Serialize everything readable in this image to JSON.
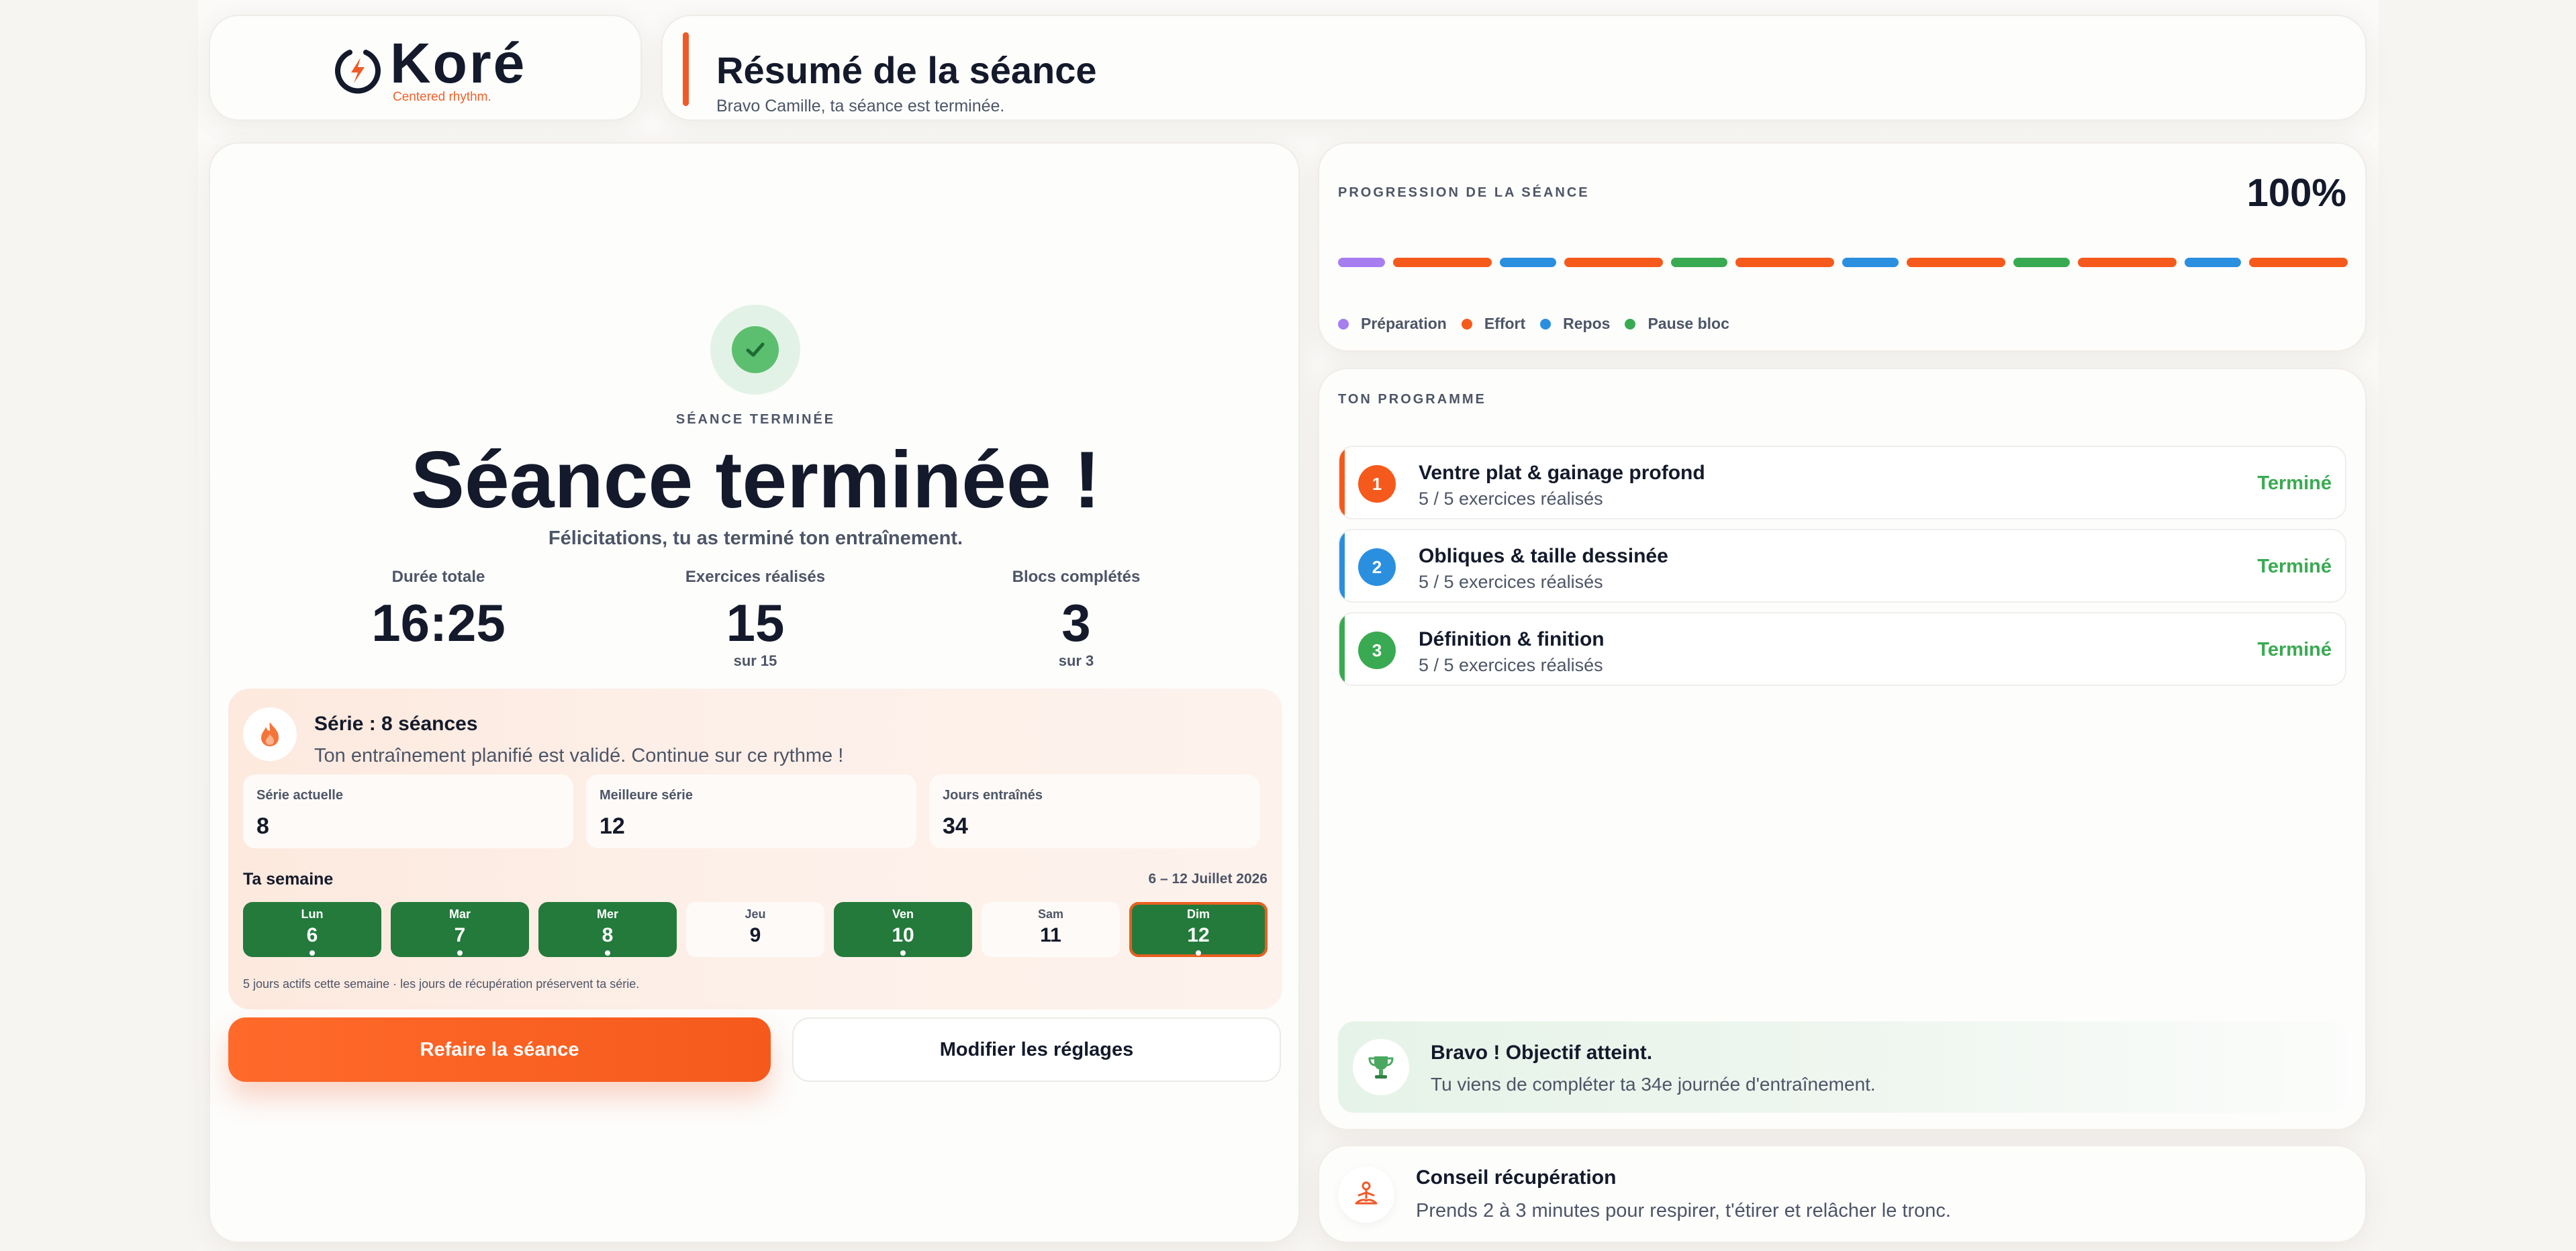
{
  "brand": {
    "name": "Koré",
    "tagline": "Centered rhythm."
  },
  "header": {
    "title": "Résumé de la séance",
    "subtitle": "Bravo Camille, ta séance est terminée."
  },
  "completion": {
    "eyebrow": "SÉANCE TERMINÉE",
    "title": "Séance terminée !",
    "subtitle": "Félicitations, tu as terminé ton entraînement."
  },
  "stats": [
    {
      "label": "Durée totale",
      "value": "16:25",
      "sub": ""
    },
    {
      "label": "Exercices réalisés",
      "value": "15",
      "sub": "sur 15"
    },
    {
      "label": "Blocs complétés",
      "value": "3",
      "sub": "sur 3"
    }
  ],
  "streak": {
    "title": "Série : 8 séances",
    "description": "Ton entraînement planifié est validé. Continue sur ce rythme !",
    "cards": [
      {
        "label": "Série actuelle",
        "value": "8"
      },
      {
        "label": "Meilleure série",
        "value": "12"
      },
      {
        "label": "Jours entraînés",
        "value": "34"
      }
    ],
    "week_title": "Ta semaine",
    "week_range": "6 – 12 Juillet 2026",
    "days": [
      {
        "name": "Lun",
        "num": "6",
        "active": true,
        "today": false
      },
      {
        "name": "Mar",
        "num": "7",
        "active": true,
        "today": false
      },
      {
        "name": "Mer",
        "num": "8",
        "active": true,
        "today": false
      },
      {
        "name": "Jeu",
        "num": "9",
        "active": false,
        "today": false
      },
      {
        "name": "Ven",
        "num": "10",
        "active": true,
        "today": false
      },
      {
        "name": "Sam",
        "num": "11",
        "active": false,
        "today": false
      },
      {
        "name": "Dim",
        "num": "12",
        "active": true,
        "today": true
      }
    ],
    "note": "5 jours actifs cette semaine · les jours de récupération préservent ta série."
  },
  "actions": {
    "primary": "Refaire la séance",
    "secondary": "Modifier les réglages"
  },
  "progression": {
    "label": "PROGRESSION DE LA SÉANCE",
    "percent": "100%",
    "percent_value": 100,
    "segments": [
      "prep",
      "effort",
      "repos",
      "effort",
      "pause",
      "effort",
      "repos",
      "effort",
      "pause",
      "effort",
      "repos",
      "effort"
    ],
    "legend": [
      {
        "key": "prep",
        "label": "Préparation",
        "color": "#a77ef0"
      },
      {
        "key": "effort",
        "label": "Effort",
        "color": "#f55a1c"
      },
      {
        "key": "repos",
        "label": "Repos",
        "color": "#2b8fe0"
      },
      {
        "key": "pause",
        "label": "Pause bloc",
        "color": "#3aaa52"
      }
    ]
  },
  "programme": {
    "label": "TON PROGRAMME",
    "blocks": [
      {
        "num": "1",
        "title": "Ventre plat & gainage profond",
        "sub": "5 / 5 exercices réalisés",
        "status": "Terminé",
        "color": "#f55a1c"
      },
      {
        "num": "2",
        "title": "Obliques & taille dessinée",
        "sub": "5 / 5 exercices réalisés",
        "status": "Terminé",
        "color": "#2b8fe0"
      },
      {
        "num": "3",
        "title": "Définition & finition",
        "sub": "5 / 5 exercices réalisés",
        "status": "Terminé",
        "color": "#3aaa52"
      }
    ],
    "goal": {
      "title": "Bravo ! Objectif atteint.",
      "sub": "Tu viens de compléter ta 34e journée d'entraînement.",
      "icon": "trophy-icon"
    }
  },
  "tip": {
    "title": "Conseil récupération",
    "sub": "Prends 2 à 3 minutes pour respirer, t'étirer et relâcher le tronc.",
    "icon": "meditation-icon"
  }
}
